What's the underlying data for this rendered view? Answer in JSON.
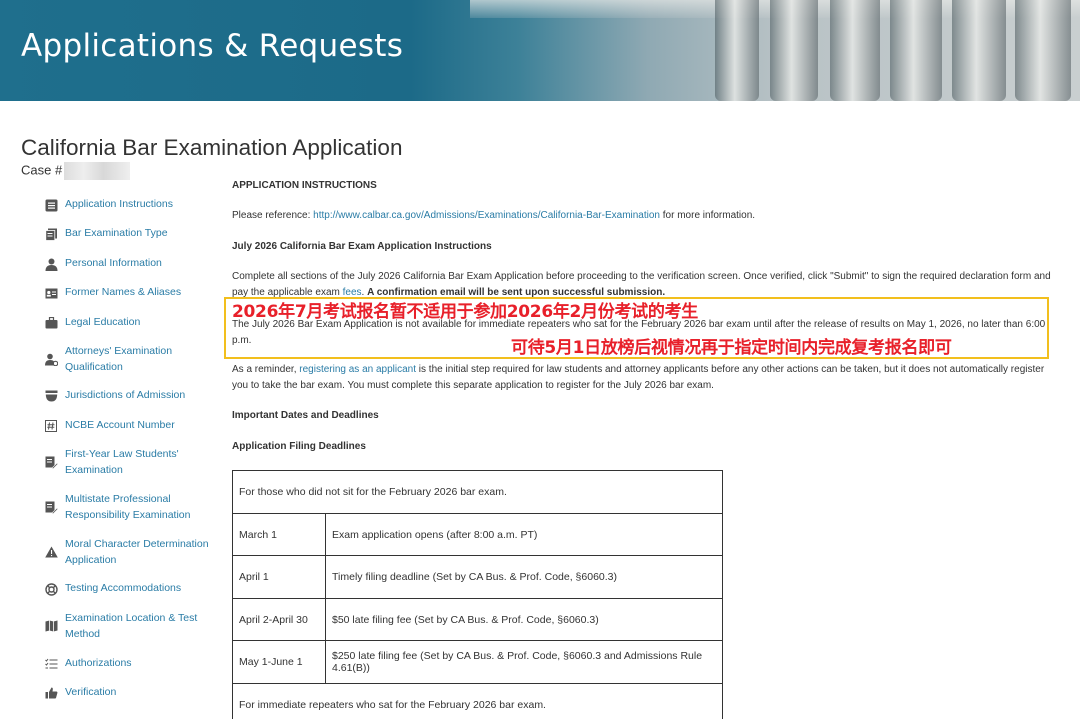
{
  "header": {
    "title": "Applications & Requests"
  },
  "page": {
    "title": "California Bar Examination Application",
    "case_label": "Case #"
  },
  "sidebar": {
    "items": [
      {
        "label": "Application Instructions",
        "icon": "list-icon"
      },
      {
        "label": "Bar Examination Type",
        "icon": "documents-icon"
      },
      {
        "label": "Personal Information",
        "icon": "person-icon"
      },
      {
        "label": "Former Names & Aliases",
        "icon": "id-card-icon"
      },
      {
        "label": "Legal Education",
        "icon": "briefcase-icon"
      },
      {
        "label": "Attorneys' Examination Qualification",
        "icon": "user-gear-icon"
      },
      {
        "label": "Jurisdictions of Admission",
        "icon": "bowl-icon"
      },
      {
        "label": "NCBE Account Number",
        "icon": "hash-icon"
      },
      {
        "label": "First-Year Law Students' Examination",
        "icon": "edit-doc-icon"
      },
      {
        "label": "Multistate Professional Responsibility Examination",
        "icon": "edit-doc-icon"
      },
      {
        "label": "Moral Character Determination Application",
        "icon": "warning-icon"
      },
      {
        "label": "Testing Accommodations",
        "icon": "lifebuoy-icon"
      },
      {
        "label": "Examination Location & Test Method",
        "icon": "map-icon"
      },
      {
        "label": "Authorizations",
        "icon": "checklist-icon"
      },
      {
        "label": "Verification",
        "icon": "thumbs-up-icon"
      }
    ]
  },
  "main": {
    "section_heading": "APPLICATION INSTRUCTIONS",
    "reference_prefix": "Please reference: ",
    "reference_link": "http://www.calbar.ca.gov/Admissions/Examinations/California-Bar-Examination",
    "reference_suffix": " for more information.",
    "july_heading": "July 2026 California Bar Exam Application Instructions",
    "complete_text_1": "Complete all sections of the July 2026 California Bar Exam Application before proceeding to the verification screen. Once verified, click \"Submit\" to sign the required declaration form and pay the applicable exam ",
    "complete_link": "fees",
    "complete_text_2": ". ",
    "complete_bold": "A confirmation email will be sent upon successful submission.",
    "repeaters_text": "The July 2026 Bar Exam Application is not available for immediate repeaters who sat for the February 2026 bar exam until after the release of results on May 1, 2026, no later than 6:00 p.m.",
    "overlay_line_1": "2026年7月考试报名暂不适用于参加2026年2月份考试的考生",
    "overlay_line_2": "可待5月1日放榜后视情况再于指定时间内完成复考报名即可",
    "reminder_prefix": "As a reminder, ",
    "reminder_link": "registering as an applicant",
    "reminder_suffix": " is the initial step required for law students and attorney applicants before any other actions can be taken, but it does not automatically register you to take the bar exam. You must complete this separate application to register for the July 2026 bar exam.",
    "dates_heading": "Important Dates and Deadlines",
    "filing_heading": "Application Filing Deadlines"
  },
  "deadlines": {
    "group_1": "For those who did not sit for the February 2026 bar exam.",
    "rows": [
      {
        "date": "March 1",
        "desc": "Exam application opens (after 8:00 a.m. PT)"
      },
      {
        "date": "April 1",
        "desc": "Timely filing deadline (Set by CA Bus. & Prof. Code, §6060.3)"
      },
      {
        "date": "April 2-April 30",
        "desc": "$50 late filing fee (Set by CA Bus. & Prof. Code, §6060.3)"
      },
      {
        "date": "May 1-June 1",
        "desc": "$250 late filing fee (Set by CA Bus. & Prof. Code, §6060.3 and Admissions Rule 4.61(B))"
      }
    ],
    "group_2": "For immediate repeaters who sat for the February 2026 bar exam."
  }
}
